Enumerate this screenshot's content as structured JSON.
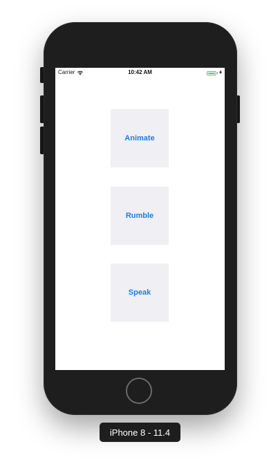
{
  "status_bar": {
    "carrier": "Carrier",
    "time": "10:42 AM",
    "wifi_icon": "wifi-icon",
    "battery_icon": "battery-icon",
    "battery_level": 1.0,
    "charging_icon": "bolt-icon"
  },
  "buttons": [
    {
      "label": "Animate"
    },
    {
      "label": "Rumble"
    },
    {
      "label": "Speak"
    }
  ],
  "device_label": "iPhone 8 - 11.4",
  "colors": {
    "button_text": "#1b7fe4",
    "button_background": "#efeff4",
    "device_frame": "#1e1e1e",
    "battery": "#4cd964"
  }
}
